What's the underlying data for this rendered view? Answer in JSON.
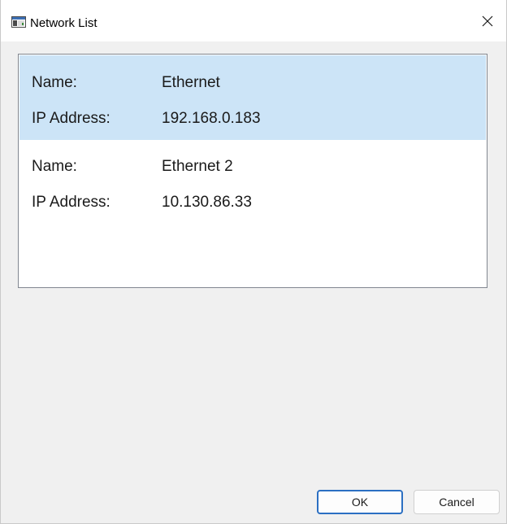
{
  "window": {
    "title": "Network List",
    "close_icon": "close-icon",
    "app_icon": "window-app-icon"
  },
  "network_list": {
    "items": [
      {
        "name_label": "Name:",
        "name": "Ethernet",
        "ip_label": "IP Address:",
        "ip": "192.168.0.183",
        "selected": true
      },
      {
        "name_label": "Name:",
        "name": "Ethernet 2",
        "ip_label": "IP Address:",
        "ip": "10.130.86.33",
        "selected": false
      }
    ]
  },
  "buttons": {
    "ok_label": "OK",
    "cancel_label": "Cancel"
  },
  "colors": {
    "selection": "#cce4f7",
    "default_button_border": "#2b6fc2",
    "dialog_background": "#f0f0f0"
  }
}
